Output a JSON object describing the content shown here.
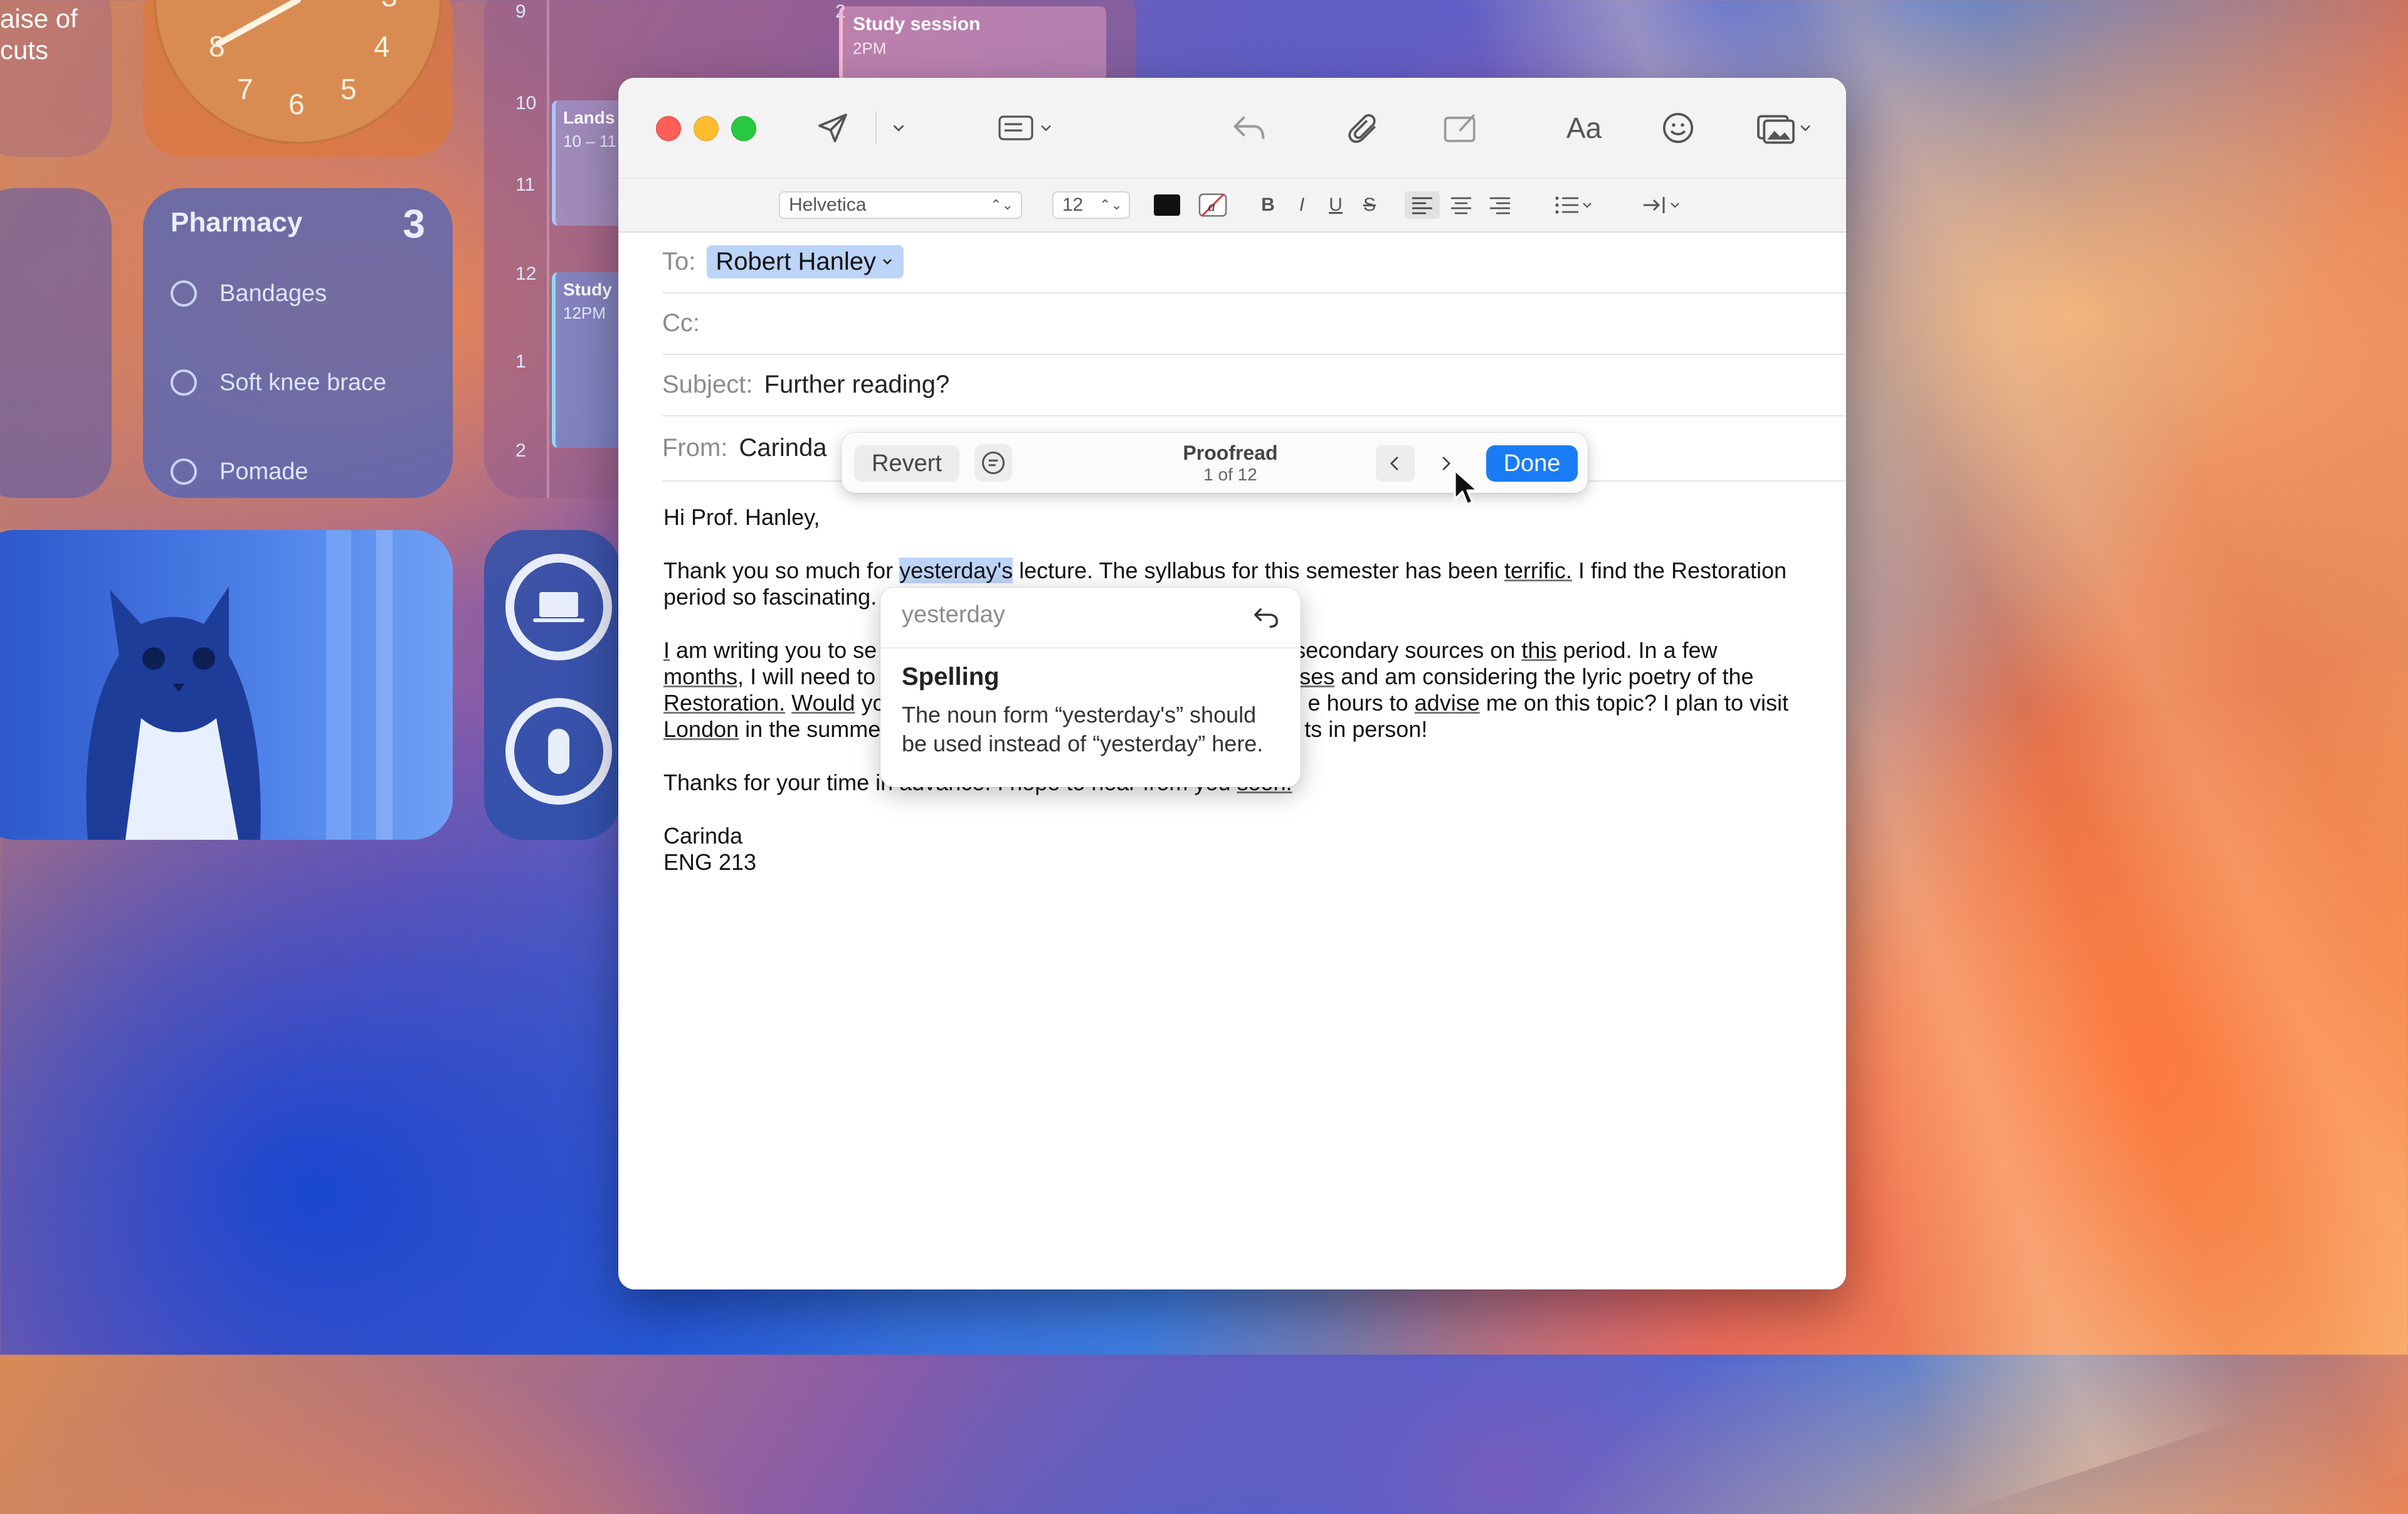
{
  "widgets": {
    "notes_partial": [
      "aise of",
      "cuts"
    ],
    "clock": {
      "numerals": [
        "8",
        "7",
        "6",
        "5",
        "4",
        "3"
      ]
    },
    "reminders": {
      "title": "Pharmacy",
      "count": "3",
      "items": [
        "Bandages",
        "Soft knee brace",
        "Pomade"
      ]
    },
    "calendar": {
      "hours": [
        "9",
        "10",
        "11",
        "12",
        "1",
        "2"
      ],
      "events": [
        {
          "title": "Study session",
          "time": "2PM"
        },
        {
          "title": "Lands",
          "time": "10 – 11"
        },
        {
          "title": "Study",
          "time": "12PM"
        }
      ]
    }
  },
  "toolbar": {
    "icons": [
      "send-icon",
      "send-options-chevron-icon",
      "header-fields-icon",
      "reply-icon",
      "attachment-icon",
      "markup-icon",
      "fonts-icon",
      "emoji-icon",
      "photo-browser-icon"
    ],
    "fonts_label": "Aa"
  },
  "format": {
    "font": "Helvetica",
    "size": "12",
    "bold": "B",
    "italic": "I",
    "underline": "U",
    "strike": "S"
  },
  "headers": {
    "to_label": "To:",
    "to_value": "Robert Hanley",
    "cc_label": "Cc:",
    "subject_label": "Subject:",
    "subject_value": "Further reading?",
    "from_label": "From:",
    "from_value": "Carinda"
  },
  "proofread": {
    "revert": "Revert",
    "title": "Proofread",
    "counter": "1 of 12",
    "done": "Done"
  },
  "suggestion": {
    "replacement": "yesterday",
    "kind": "Spelling",
    "description": "The noun form “yesterday's” should be used instead of “yesterday” here."
  },
  "body": {
    "greeting": "Hi Prof. Hanley,",
    "p1_a": "Thank you so much for ",
    "p1_hl": "yesterday's",
    "p1_b": " lecture. The syllabus for this semester has been ",
    "p1_u": "terrific.",
    "p1_c": " I find the Restoration",
    "p1_line2": "period so fascinating.",
    "p2_l1_a": "I",
    "p2_l1_b": " am writing you to se",
    "p2_l1_c": "secondary sources on ",
    "p2_l1_d": "this",
    "p2_l1_e": " period. In a few",
    "p2_l2_a": "months,",
    "p2_l2_b": " I will need to",
    "p2_l2_c": "ses",
    "p2_l2_d": " and am considering the lyric poetry of the",
    "p2_l3_a": "Restoration.",
    "p2_l3_b": " ",
    "p2_l3_c": "Would",
    "p2_l3_d": " yo",
    "p2_l3_e": "e hours to ",
    "p2_l3_f": "advise",
    "p2_l3_g": " me on this topic? I plan to visit",
    "p2_l4_a": "London",
    "p2_l4_b": " in the summe",
    "p2_l4_c": "ts in person!",
    "p3_a": "Thanks for your time in advance. I hope to hear from you ",
    "p3_u": "soon.",
    "sign_name": "Carinda",
    "sign_course": "ENG 213"
  },
  "colors": {
    "accent": "#1a7cf5",
    "close": "#fe5f57",
    "minimize": "#febc2e",
    "zoom": "#28c840",
    "highlight": "#bcd4f7"
  }
}
